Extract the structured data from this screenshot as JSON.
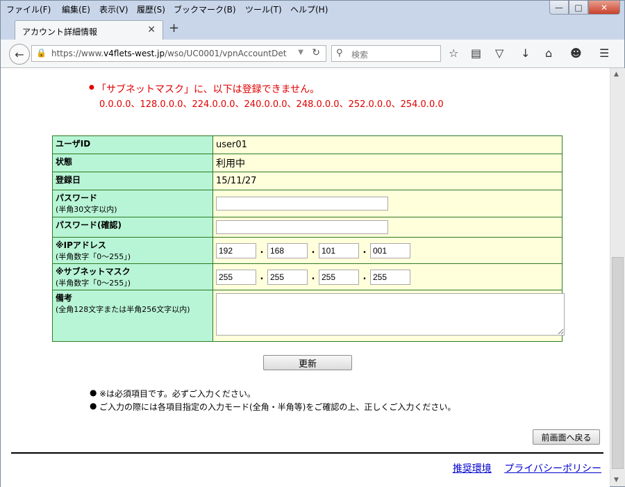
{
  "browser": {
    "menu": [
      "ファイル(F)",
      "編集(E)",
      "表示(V)",
      "履歴(S)",
      "ブックマーク(B)",
      "ツール(T)",
      "ヘルプ(H)"
    ],
    "tab_title": "アカウント詳細情報",
    "url_prefix": "https://www.",
    "url_domain": "v4flets-west.jp",
    "url_path": "/wso/UC0001/vpnAccountDet",
    "search_placeholder": "検索",
    "icons": [
      "back-arrow-icon",
      "lock-icon",
      "reload-icon",
      "search-icon",
      "star-icon",
      "reader-icon",
      "pocket-icon",
      "download-icon",
      "home-icon",
      "smiley-icon",
      "hamburger-menu-icon"
    ]
  },
  "error": {
    "message": "「サブネットマスク」に、以下は登録できません。",
    "values": "0.0.0.0、128.0.0.0、224.0.0.0、240.0.0.0、248.0.0.0、252.0.0.0、254.0.0.0"
  },
  "form": {
    "user_id": {
      "label": "ユーザID",
      "value": "user01"
    },
    "status": {
      "label": "状態",
      "value": "利用中"
    },
    "registered": {
      "label": "登録日",
      "value": "15/11/27"
    },
    "password": {
      "label": "パスワード",
      "sub": "(半角30文字以内)",
      "value": ""
    },
    "password_confirm": {
      "label": "パスワード(確認)",
      "value": ""
    },
    "ip": {
      "label": "※IPアドレス",
      "sub": "(半角数字「0〜255」)",
      "octets": [
        "192",
        "168",
        "101",
        "001"
      ]
    },
    "mask": {
      "label": "※サブネットマスク",
      "sub": "(半角数字「0〜255」)",
      "octets": [
        "255",
        "255",
        "255",
        "255"
      ]
    },
    "memo": {
      "label": "備考",
      "sub": "(全角128文字または半角256文字以内)",
      "value": ""
    },
    "separator": "."
  },
  "buttons": {
    "update": "更新",
    "back": "前画面へ戻る"
  },
  "notes": [
    "※は必須項目です。必ずご入力ください。",
    "ご入力の際には各項目指定の入力モード(全角・半角等)をご確認の上、正しくご入力ください。"
  ],
  "footer": {
    "links": [
      "推奨環境",
      "プライバシーポリシー"
    ]
  },
  "colors": {
    "label_bg": "#b8f5d6",
    "value_bg": "#ffffdc",
    "border": "#2d7a1f",
    "error": "#e00000",
    "link": "#0000cc"
  }
}
